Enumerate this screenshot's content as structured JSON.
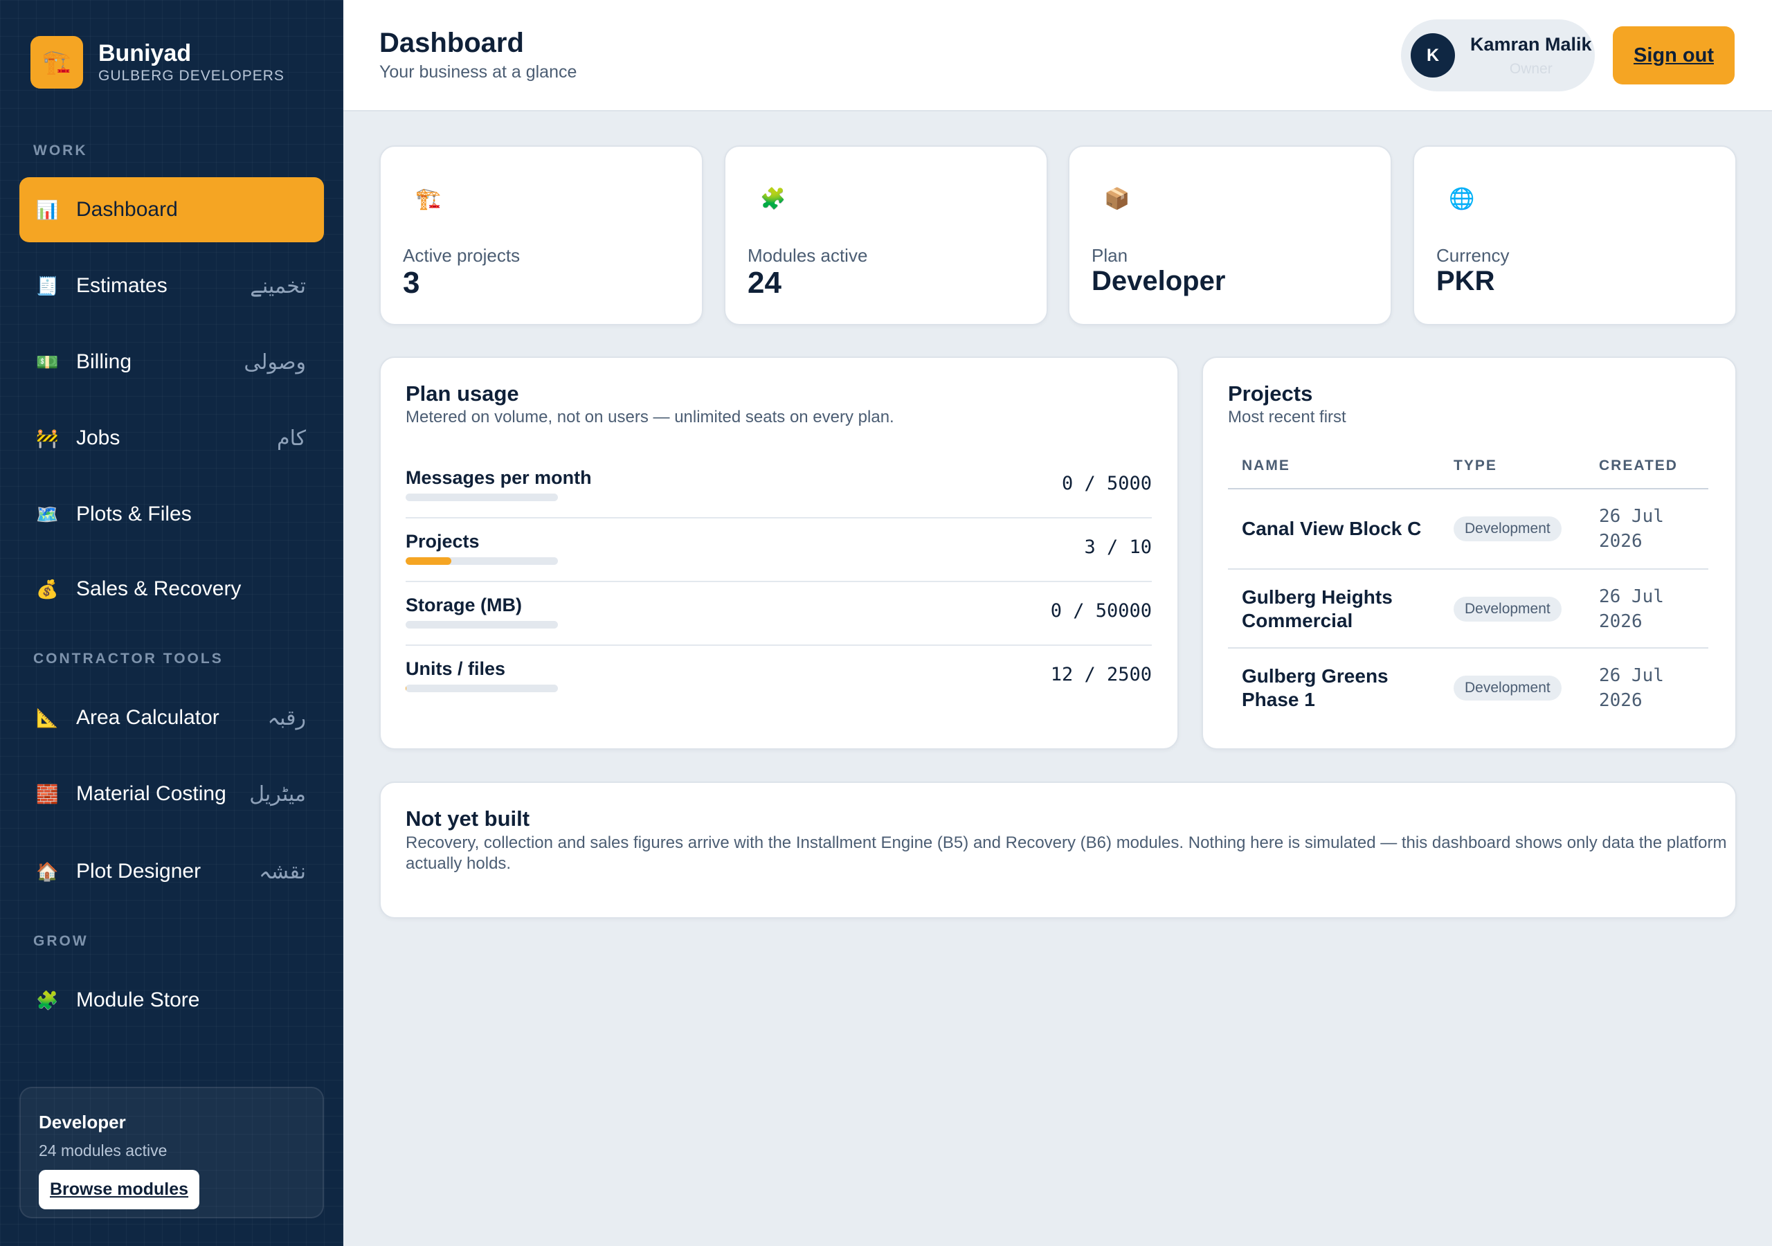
{
  "brand": {
    "icon": "🏗️",
    "name": "Buniyad",
    "subtitle": "GULBERG DEVELOPERS"
  },
  "sidebar": {
    "sections": {
      "work": "WORK",
      "contractor": "CONTRACTOR TOOLS",
      "grow": "GROW"
    },
    "items": [
      {
        "icon": "📊",
        "label": "Dashboard",
        "urdu": ""
      },
      {
        "icon": "🧾",
        "label": "Estimates",
        "urdu": "تخمینے"
      },
      {
        "icon": "💵",
        "label": "Billing",
        "urdu": "وصولی"
      },
      {
        "icon": "🚧",
        "label": "Jobs",
        "urdu": "کام"
      },
      {
        "icon": "🗺️",
        "label": "Plots & Files",
        "urdu": ""
      },
      {
        "icon": "💰",
        "label": "Sales & Recovery",
        "urdu": ""
      },
      {
        "icon": "📐",
        "label": "Area Calculator",
        "urdu": "رقبہ"
      },
      {
        "icon": "🧱",
        "label": "Material Costing",
        "urdu": "میٹریل"
      },
      {
        "icon": "🏠",
        "label": "Plot Designer",
        "urdu": "نقشہ"
      },
      {
        "icon": "🧩",
        "label": "Module Store",
        "urdu": ""
      }
    ],
    "plan_card": {
      "title": "Developer",
      "subtitle": "24 modules active",
      "button": "Browse modules"
    }
  },
  "header": {
    "title": "Dashboard",
    "subtitle": "Your business at a glance",
    "user": {
      "initial": "K",
      "name": "Kamran Malik",
      "role": "Owner"
    },
    "signout": "Sign out"
  },
  "stats": [
    {
      "icon": "🏗️",
      "label": "Active projects",
      "value": "3"
    },
    {
      "icon": "🧩",
      "label": "Modules active",
      "value": "24"
    },
    {
      "icon": "📦",
      "label": "Plan",
      "value": "Developer"
    },
    {
      "icon": "🌐",
      "label": "Currency",
      "value": "PKR"
    }
  ],
  "plan_usage": {
    "title": "Plan usage",
    "subtitle": "Metered on volume, not on users — unlimited seats on every plan.",
    "rows": [
      {
        "name": "Messages per month",
        "value": "0 / 5000",
        "fraction": 0.0
      },
      {
        "name": "Projects",
        "value": "3 / 10",
        "fraction": 0.3
      },
      {
        "name": "Storage (MB)",
        "value": "0 / 50000",
        "fraction": 0.0
      },
      {
        "name": "Units / files",
        "value": "12 / 2500",
        "fraction": 0.0048
      }
    ]
  },
  "projects": {
    "title": "Projects",
    "subtitle": "Most recent first",
    "columns": [
      "NAME",
      "TYPE",
      "CREATED"
    ],
    "rows": [
      {
        "name": "Canal View Block C",
        "type": "Development",
        "created": "26 Jul 2026"
      },
      {
        "name": "Gulberg Heights Commercial",
        "type": "Development",
        "created": "26 Jul 2026"
      },
      {
        "name": "Gulberg Greens Phase 1",
        "type": "Development",
        "created": "26 Jul 2026"
      }
    ]
  },
  "not_built": {
    "title": "Not yet built",
    "text": "Recovery, collection and sales figures arrive with the Installment Engine (B5) and Recovery (B6) modules. Nothing here is simulated — this dashboard shows only data the platform actually holds."
  },
  "colors": {
    "accent": "#f5a523",
    "sidebar": "#0f2743",
    "background": "#e8edf2",
    "text": "#0f2038"
  }
}
